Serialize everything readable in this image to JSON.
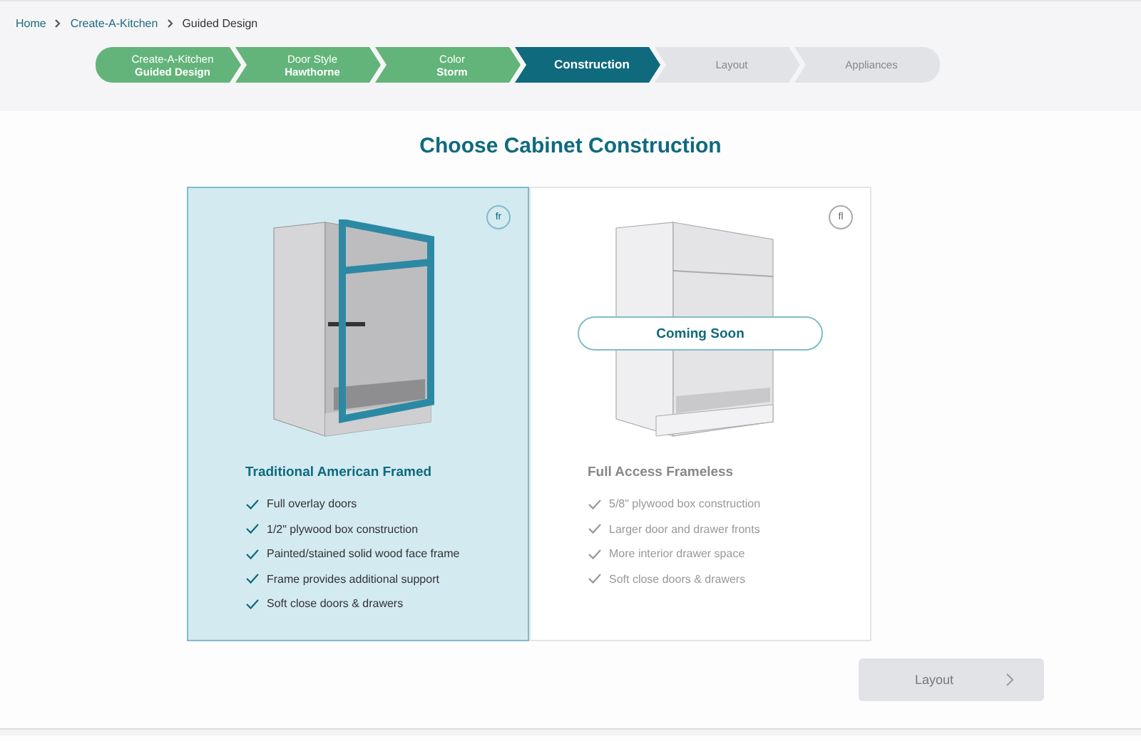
{
  "breadcrumbs": [
    {
      "label": "Home",
      "link": true
    },
    {
      "label": "Create-A-Kitchen",
      "link": true
    },
    {
      "label": "Guided Design",
      "link": false
    }
  ],
  "steps": [
    {
      "label": "Create-A-Kitchen",
      "value": "Guided Design",
      "completed": true,
      "selected": false
    },
    {
      "label": "Door Style",
      "value": "Hawthorne",
      "completed": true,
      "selected": false
    },
    {
      "label": "Color",
      "value": "Storm",
      "completed": true,
      "selected": false
    },
    {
      "value": "Construction",
      "completed": false,
      "selected": true
    },
    {
      "value": "Layout",
      "completed": false,
      "selected": false
    },
    {
      "value": "Appliances",
      "completed": false,
      "selected": false
    }
  ],
  "heading": "Choose Cabinet Construction",
  "options": [
    {
      "code": "fr",
      "kind": "framed",
      "title": "Traditional American Framed",
      "selected": true,
      "features": [
        "Full overlay doors",
        "1/2\" plywood box construction",
        "Painted/stained solid wood face frame",
        "Frame provides additional support",
        "Soft close doors & drawers"
      ]
    },
    {
      "code": "fl",
      "kind": "frameless",
      "title": "Full Access Frameless",
      "selected": false,
      "badge": "Coming Soon",
      "features": [
        "5/8\" plywood box construction",
        "Larger door and drawer fronts",
        "More interior drawer space",
        "Soft close doors & drawers"
      ]
    }
  ],
  "next_button": {
    "label": "Layout",
    "disabled": true
  }
}
